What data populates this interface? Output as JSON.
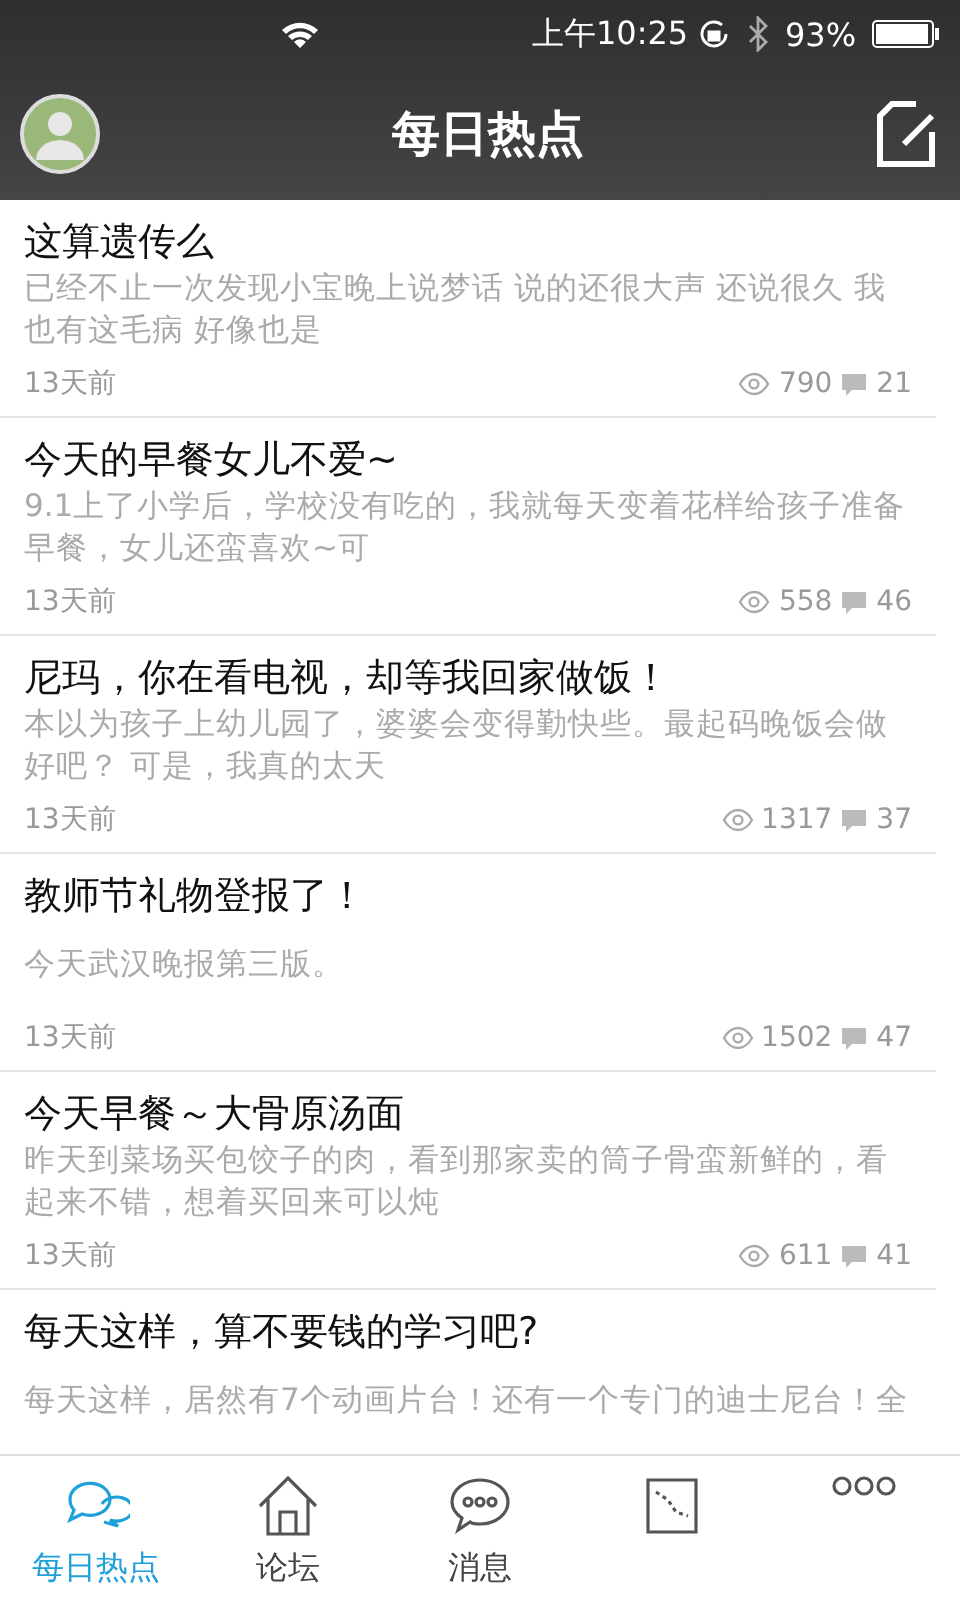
{
  "status_bar": {
    "time": "上午10:25",
    "battery": "93%"
  },
  "header": {
    "title": "每日热点"
  },
  "posts": [
    {
      "title": "这算遗传么",
      "body": "已经不止一次发现小宝晚上说梦话 说的还很大声 还说很久  我也有这毛病 好像也是",
      "time": "13天前",
      "views": "790",
      "comments": "21"
    },
    {
      "title": "今天的早餐女儿不爱~",
      "body": "9.1上了小学后，学校没有吃的，我就每天变着花样给孩子准备早餐，女儿还蛮喜欢~可",
      "time": "13天前",
      "views": "558",
      "comments": "46"
    },
    {
      "title": "尼玛，你在看电视，却等我回家做饭！",
      "body": "本以为孩子上幼儿园了，婆婆会变得勤快些。最起码晚饭会做好吧？  可是，我真的太天",
      "time": "13天前",
      "views": "1317",
      "comments": "37"
    },
    {
      "title": "教师节礼物登报了！",
      "body": "今天武汉晚报第三版。",
      "time": "13天前",
      "views": "1502",
      "comments": "47"
    },
    {
      "title": "今天早餐～大骨原汤面",
      "body": "昨天到菜场买包饺子的肉，看到那家卖的筒子骨蛮新鲜的，看起来不错，想着买回来可以炖",
      "time": "13天前",
      "views": "611",
      "comments": "41"
    },
    {
      "title": "每天这样，算不要钱的学习吧?",
      "body": "每天这样，居然有7个动画片台！还有一个专门的迪士尼台！全"
    }
  ],
  "tabs": [
    {
      "kind": "chat",
      "label": "每日热点",
      "selected": true
    },
    {
      "kind": "home",
      "label": "论坛",
      "selected": false
    },
    {
      "kind": "message",
      "label": "消息",
      "selected": false
    },
    {
      "kind": "map",
      "selected": false
    },
    {
      "kind": "more",
      "selected": false
    }
  ]
}
